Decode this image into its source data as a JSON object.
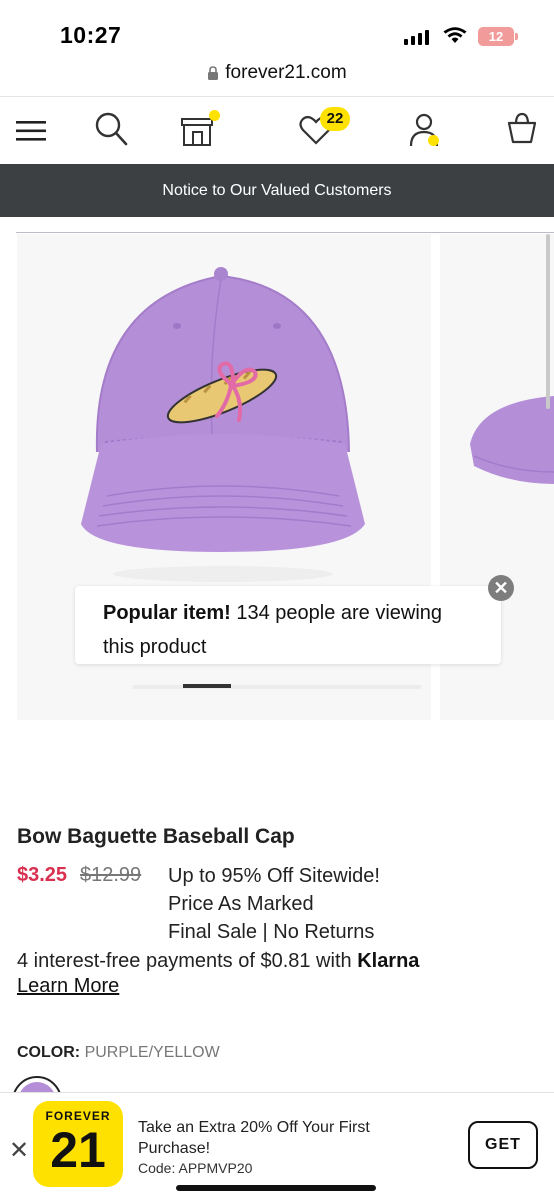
{
  "status_bar": {
    "time": "10:27",
    "battery": "12"
  },
  "browser": {
    "url": "forever21.com"
  },
  "nav": {
    "menu_icon": "menu-icon",
    "search_icon": "search-icon",
    "store_icon": "store-icon",
    "favorites_icon": "heart-icon",
    "favorites_count": "22",
    "account_icon": "user-icon",
    "bag_icon": "shopping-bag-icon"
  },
  "notice": {
    "text": "Notice to Our Valued Customers"
  },
  "popup": {
    "bold": "Popular item!",
    "text": " 134 people are viewing this product"
  },
  "product": {
    "title": "Bow Baguette Baseball Cap",
    "sale_price": "$3.25",
    "original_price": "$12.99",
    "promo_lines": [
      "Up to 95% Off Sitewide!",
      "Price As Marked",
      "Final Sale | No Returns"
    ],
    "klarna_text": "4 interest-free payments of $0.81 with ",
    "klarna_brand": "Klarna",
    "learn_more": "Learn More",
    "color_label": "COLOR:",
    "color_value": "PURPLE/YELLOW",
    "gallery_page": 1,
    "gallery_pages": 6
  },
  "banner": {
    "app_top": "FOREVER",
    "app_num": "21",
    "line1": "Take an Extra 20% Off Your First Purchase!",
    "code": "Code: APPMVP20",
    "get": "GET",
    "close": "✕"
  },
  "colors": {
    "accent_yellow": "#ffe100",
    "notice_bg": "#3c4043",
    "sale_red": "#d9304f",
    "cap_purple": "#b48fd8"
  }
}
